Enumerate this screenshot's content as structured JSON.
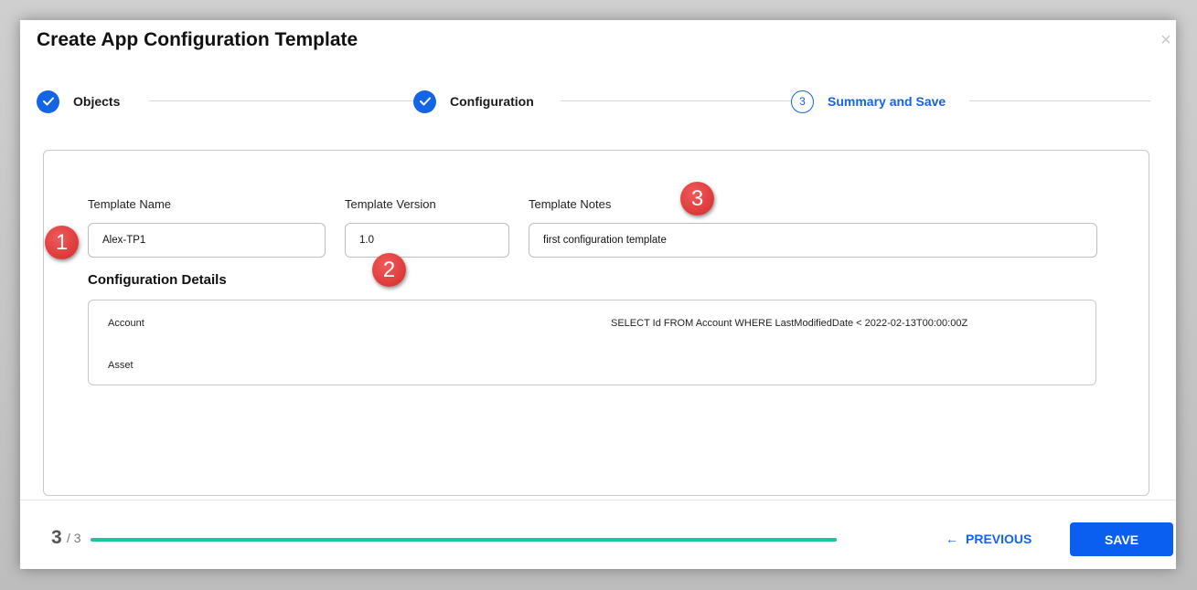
{
  "dialog": {
    "title": "Create App Configuration Template",
    "close_icon": "×"
  },
  "stepper": {
    "steps": [
      {
        "number": "",
        "label": "Objects",
        "state": "done"
      },
      {
        "number": "",
        "label": "Configuration",
        "state": "done"
      },
      {
        "number": "3",
        "label": "Summary and Save",
        "state": "current"
      }
    ]
  },
  "form": {
    "template_name_label": "Template Name",
    "template_name_value": "Alex-TP1",
    "template_version_label": "Template Version",
    "template_version_value": "1.0",
    "template_notes_label": "Template Notes",
    "template_notes_value": "first configuration template"
  },
  "details": {
    "title": "Configuration Details",
    "rows": [
      {
        "object": "Account",
        "query": "SELECT Id FROM Account WHERE LastModifiedDate < 2022-02-13T00:00:00Z"
      },
      {
        "object": "Asset",
        "query": ""
      }
    ]
  },
  "annotations": [
    "1",
    "2",
    "3"
  ],
  "footer": {
    "current_step": "3",
    "total_steps": "/ 3",
    "progress_fraction": 1.0,
    "previous_label": "PREVIOUS",
    "previous_icon": "←",
    "save_label": "SAVE"
  },
  "colors": {
    "accent": "#1464e6",
    "progress": "#17c6a3",
    "annotation": "#e03a3a"
  }
}
